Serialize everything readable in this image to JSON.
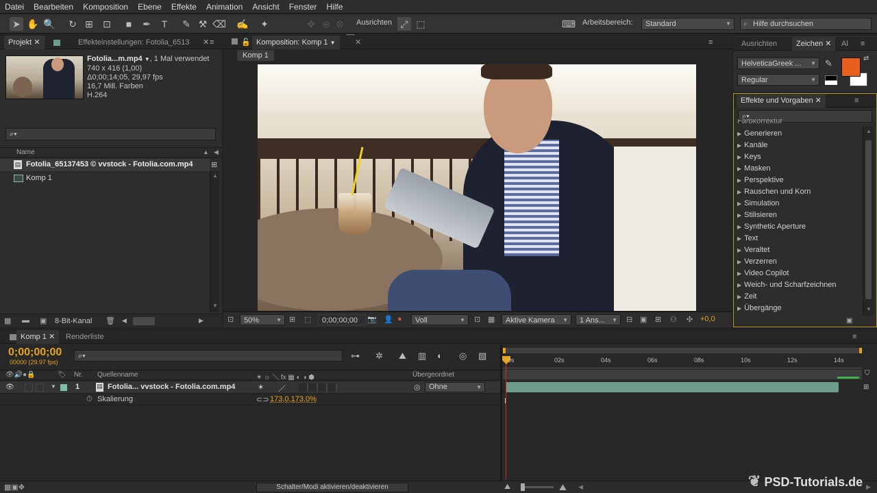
{
  "menu": [
    "Datei",
    "Bearbeiten",
    "Komposition",
    "Ebene",
    "Effekte",
    "Animation",
    "Ansicht",
    "Fenster",
    "Hilfe"
  ],
  "toolbar": {
    "ausrichten_label": "Ausrichten",
    "arbeitsbereich_label": "Arbeitsbereich:",
    "arbeitsbereich_value": "Standard",
    "help_placeholder": "Hilfe durchsuchen"
  },
  "project_panel": {
    "tab_label": "Projekt",
    "tab2_label": "Effekteinstellungen: Fotolia_6513",
    "file_name": "Fotolia...m.mp4",
    "file_usage": ", 1 Mal verwendet",
    "file_info": [
      "740 x 416 (1,00)",
      "Δ0;00;14;05, 29,97 fps",
      "16,7 Mill. Farben",
      "H.264"
    ],
    "column_name": "Name",
    "items": [
      "Fotolia_65137453 © vvstock - Fotolia.com.mp4",
      "Komp 1"
    ],
    "bit_depth": "8-Bit-Kanal"
  },
  "comp_panel": {
    "tab_label": "Komposition: Komp 1",
    "sub_tab": "Komp 1",
    "zoom": "50%",
    "timecode": "0;00;00;00",
    "resolution": "Voll",
    "camera": "Aktive Kamera",
    "views": "1 Ans...",
    "exposure": "+0,0"
  },
  "char_panel": {
    "tab_align": "Ausrichten",
    "tab_char": "Zeichen",
    "tab_ai": "Al",
    "font_family": "HelveticaGreek ...",
    "font_style": "Regular",
    "fill_color": "#e8601c"
  },
  "effects_panel": {
    "tab_label": "Effekte und Vorgaben",
    "partial_top": "Farbkorrektur",
    "items": [
      "Generieren",
      "Kanäle",
      "Keys",
      "Masken",
      "Perspektive",
      "Rauschen und Korn",
      "Simulation",
      "Stilisieren",
      "Synthetic Aperture",
      "Text",
      "Veraltet",
      "Verzerren",
      "Video Copilot",
      "Weich- und Scharfzeichnen",
      "Zeit",
      "Übergänge"
    ]
  },
  "timeline": {
    "tab_label": "Komp 1",
    "tab2_label": "Renderliste",
    "timecode": "0;00;00;00",
    "fps_info": "00000 (29.97 fps)",
    "col_nr": "Nr.",
    "col_source": "Quellenname",
    "col_parent": "Übergeordnet",
    "layer_number": "1",
    "layer_name": "Fotolia... vvstock - Fotolia.com.mp4",
    "parent_value": "Ohne",
    "property_name": "Skalierung",
    "property_value": "173,0,173,0%",
    "ruler": [
      "0s",
      "02s",
      "04s",
      "06s",
      "08s",
      "10s",
      "12s",
      "14s"
    ],
    "footer_toggle": "Schalter/Modi aktivieren/deaktivieren",
    "accent": "#e6a31e"
  },
  "watermark": "PSD-Tutorials.de"
}
